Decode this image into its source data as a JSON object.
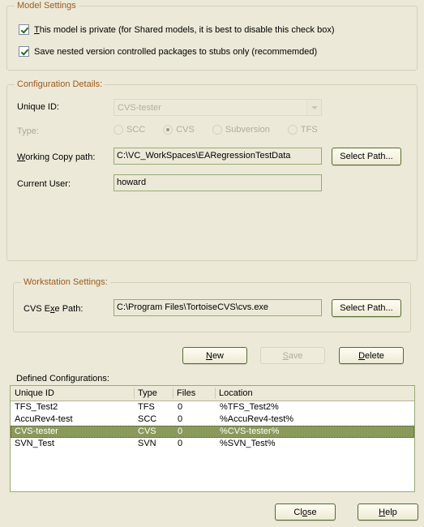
{
  "model_settings": {
    "legend": "Model Settings",
    "checkboxes": [
      {
        "label_pre": "",
        "accel": "T",
        "label_post": "his model is private (for Shared models, it is best to disable this check box)",
        "checked": true
      },
      {
        "label_pre": "Save nested version controlled packages to stubs only (recommemded)",
        "accel": "",
        "label_post": "",
        "checked": true
      }
    ]
  },
  "configuration_details": {
    "legend": "Configuration Details:",
    "unique_id": {
      "label": "Unique ID:",
      "value": "CVS-tester",
      "disabled": true,
      "dropdown_icon": "chevron-down-icon"
    },
    "type": {
      "label": "Type:",
      "disabled": true,
      "options": [
        {
          "label": "SCC",
          "selected": false
        },
        {
          "label": "CVS",
          "selected": true
        },
        {
          "label": "Subversion",
          "selected": false
        },
        {
          "label": "TFS",
          "selected": false
        }
      ]
    },
    "working_copy_path": {
      "label_pre": "",
      "accel": "W",
      "label_post": "orking Copy path:",
      "value": "C:\\VC_WorkSpaces\\EARegressionTestData",
      "button": "Select Path..."
    },
    "current_user": {
      "label": "Current User:",
      "value": "howard"
    }
  },
  "workstation_settings": {
    "legend": "Workstation Settings:",
    "cvs_exe_path": {
      "label_pre": "CVS E",
      "accel": "x",
      "label_post": "e Path:",
      "value": "C:\\Program Files\\TortoiseCVS\\cvs.exe",
      "button": "Select Path..."
    }
  },
  "action_buttons": {
    "new": {
      "label_pre": "",
      "accel": "N",
      "label_post": "ew",
      "disabled": false
    },
    "save": {
      "label_pre": "",
      "accel": "S",
      "label_post": "ave",
      "disabled": true
    },
    "delete": {
      "label_pre": "",
      "accel": "D",
      "label_post": "elete",
      "disabled": false
    }
  },
  "defined_configurations": {
    "label": "Defined Configurations:",
    "columns": [
      "Unique ID",
      "Type",
      "Files",
      "Location"
    ],
    "rows": [
      {
        "unique_id": "TFS_Test2",
        "type": "TFS",
        "files": "0",
        "location": "%TFS_Test2%",
        "selected": false
      },
      {
        "unique_id": "AccuRev4-test",
        "type": "SCC",
        "files": "0",
        "location": "%AccuRev4-test%",
        "selected": false
      },
      {
        "unique_id": "CVS-tester",
        "type": "CVS",
        "files": "0",
        "location": "%CVS-tester%",
        "selected": true
      },
      {
        "unique_id": "SVN_Test",
        "type": "SVN",
        "files": "0",
        "location": "%SVN_Test%",
        "selected": false
      }
    ]
  },
  "dialog_buttons": {
    "close": {
      "label_pre": "Cl",
      "accel": "o",
      "label_post": "se"
    },
    "help": {
      "label_pre": "",
      "accel": "H",
      "label_post": "elp"
    }
  },
  "colors": {
    "window_background": "#ece9d8",
    "group_legend": "#9c5a1e",
    "field_border": "#9aab74",
    "button_border": "#556b2f",
    "selection": "#8a9a5b",
    "disabled_text": "#aca899",
    "checkbox_check": "#2f6b22"
  }
}
